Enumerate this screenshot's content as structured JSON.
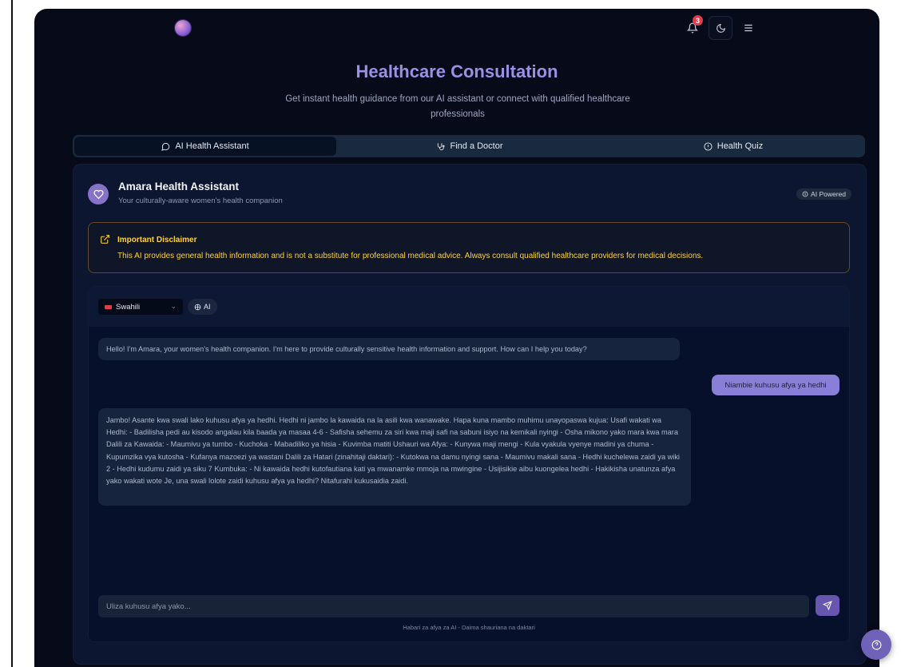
{
  "header": {
    "notifications_count": "3",
    "title": "Healthcare Consultation",
    "subtitle": "Get instant health guidance from our AI assistant or connect with qualified healthcare professionals"
  },
  "tabs": [
    {
      "label": "AI Health Assistant",
      "icon": "chat-bubble-icon",
      "active": true
    },
    {
      "label": "Find a Doctor",
      "icon": "stethoscope-icon",
      "active": false
    },
    {
      "label": "Health Quiz",
      "icon": "quiz-icon",
      "active": false
    }
  ],
  "assistant": {
    "name": "Amara Health Assistant",
    "tagline": "Your culturally-aware women's health companion",
    "badge": "AI Powered"
  },
  "disclaimer": {
    "title": "Important Disclaimer",
    "text": "This AI provides general health information and is not a substitute for professional medical advice. Always consult qualified healthcare providers for medical decisions."
  },
  "chat": {
    "language": "Swahili",
    "mode_badge": "AI",
    "messages": [
      {
        "role": "bot",
        "text": "Hello! I'm Amara, your women's health companion. I'm here to provide culturally sensitive health information and support. How can I help you today?"
      },
      {
        "role": "user",
        "text": "Niambie kuhusu afya ya hedhi"
      },
      {
        "role": "bot",
        "text": "Jambo! Asante kwa swali lako kuhusu afya ya hedhi. Hedhi ni jambo la kawaida na la asili kwa wanawake. Hapa kuna mambo muhimu unayopaswa kujua: Usafi wakati wa Hedhi: - Badilisha pedi au kisodo angalau kila baada ya masaa 4-6 - Safisha sehemu za siri kwa maji safi na sabuni isiyo na kemikali nyingi - Osha mikono yako mara kwa mara Dalili za Kawaida: - Maumivu ya tumbo - Kuchoka - Mabadiliko ya hisia - Kuvimba matiti Ushauri wa Afya: - Kunywa maji mengi - Kula vyakula vyenye madini ya chuma - Kupumzika vya kutosha - Kufanya mazoezi ya wastani Dalili za Hatari (zinahitaji daktari): - Kutokwa na damu nyingi sana - Maumivu makali sana - Hedhi kuchelewa zaidi ya wiki 2 - Hedhi kudumu zaidi ya siku 7 Kumbuka: - Ni kawaida hedhi kutofautiana kati ya mwanamke mmoja na mwingine - Usijisikie aibu kuongelea hedhi - Hakikisha unatunza afya yako wakati wote Je, una swali lolote zaidi kuhusu afya ya hedhi? Nitafurahi kukusaidia zaidi."
      }
    ],
    "input_placeholder": "Uliza kuhusu afya yako...",
    "footer_note": "Habari za afya za AI - Daima shauriana na daktari"
  },
  "colors": {
    "accent": "#8a7fd8",
    "background": "#070b19",
    "warning": "#ffd23a",
    "badge_red": "#e23b4a"
  }
}
